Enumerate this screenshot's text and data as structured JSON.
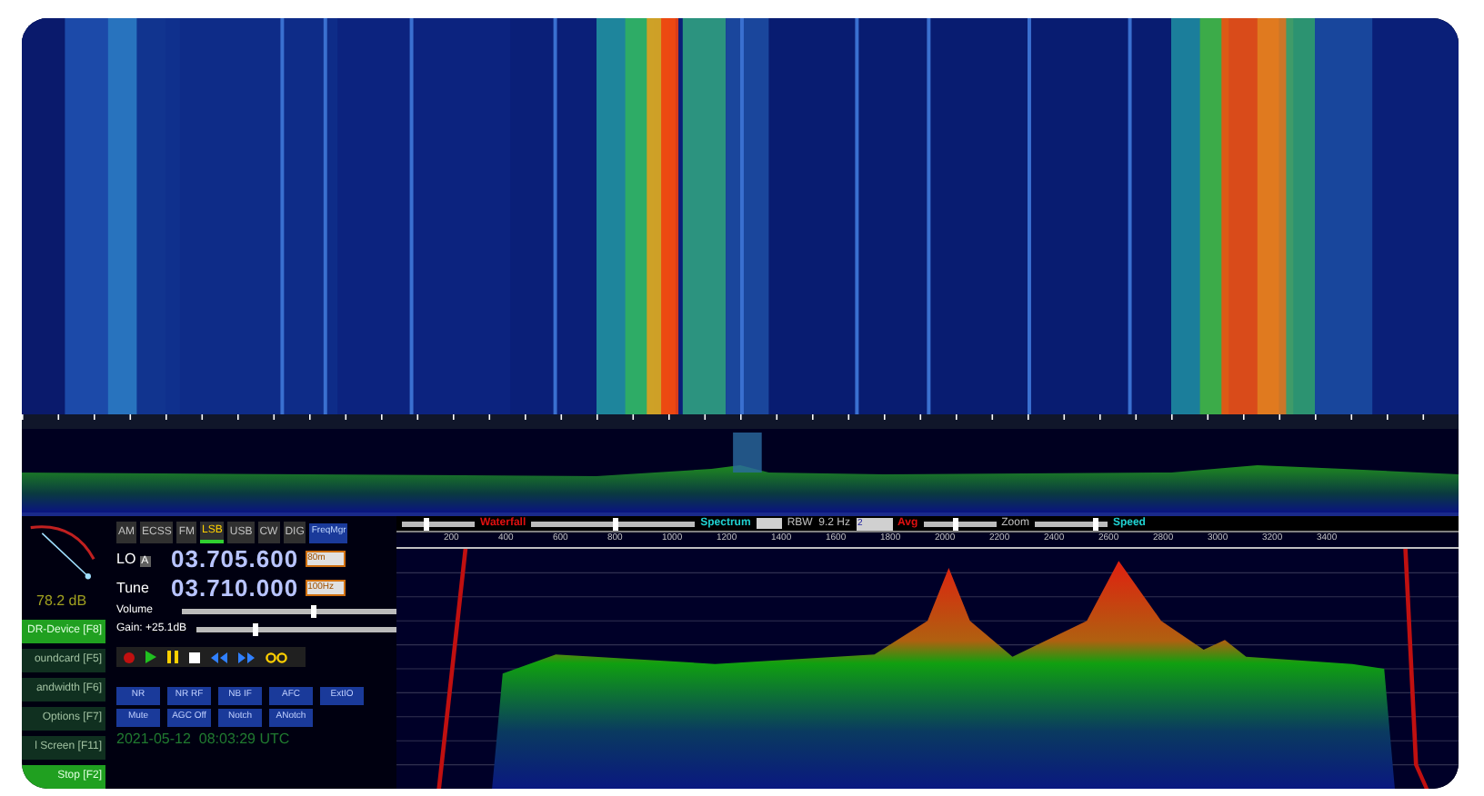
{
  "modes": [
    {
      "label": "AM",
      "selected": false
    },
    {
      "label": "ECSS",
      "selected": false
    },
    {
      "label": "FM",
      "selected": false
    },
    {
      "label": "LSB",
      "selected": true
    },
    {
      "label": "USB",
      "selected": false
    },
    {
      "label": "CW",
      "selected": false
    },
    {
      "label": "DIG",
      "selected": false
    }
  ],
  "freq_mgr": "FreqMgr",
  "meter": {
    "reading": "78.2 dB"
  },
  "lo": {
    "label": "LO",
    "badge": "A",
    "value": "03.705.600",
    "select": "80m"
  },
  "tune": {
    "label": "Tune",
    "value": "03.710.000",
    "select": "100Hz"
  },
  "volume": {
    "label": "Volume",
    "level": 0.6
  },
  "gain": {
    "label": "Gain: +25.1dB",
    "level": 0.28
  },
  "side_buttons": [
    {
      "label": "DR-Device [F8]",
      "selected": true
    },
    {
      "label": "oundcard [F5]",
      "selected": false
    },
    {
      "label": "andwidth [F6]",
      "selected": false
    },
    {
      "label": "Options [F7]",
      "selected": false
    },
    {
      "label": "l Screen [F11]",
      "selected": false
    },
    {
      "label": "Stop [F2]",
      "selected": true
    }
  ],
  "dsp_buttons": [
    {
      "label": "NR"
    },
    {
      "label": "NR RF"
    },
    {
      "label": "NB IF"
    },
    {
      "label": "AFC"
    },
    {
      "label": "ExtIO"
    },
    {
      "label": "Mute"
    },
    {
      "label": "AGC Off"
    },
    {
      "label": "Notch"
    },
    {
      "label": "ANotch"
    }
  ],
  "clock": "2021-05-12  08:03:29 UTC",
  "spectrum_bar": {
    "waterfall": "Waterfall",
    "spectrum": "Spectrum",
    "rbw": "RBW  9.2 Hz",
    "avg_select": "2",
    "avg": "Avg",
    "zoom": "Zoom",
    "speed": "Speed"
  },
  "audio_scale": [
    "200",
    "400",
    "600",
    "800",
    "1000",
    "1200",
    "1400",
    "1600",
    "1800",
    "2000",
    "2200",
    "2400",
    "2600",
    "2800",
    "3000",
    "3200",
    "3400"
  ]
}
